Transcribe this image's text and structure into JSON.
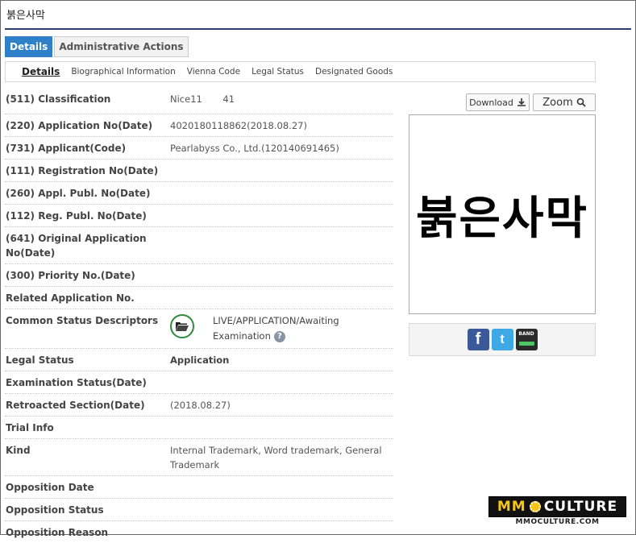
{
  "page_title": "붉은사막",
  "tabs": [
    {
      "label": "Details",
      "active": true
    },
    {
      "label": "Administrative Actions",
      "active": false
    }
  ],
  "subnav": [
    "Details",
    "Biographical Information",
    "Vienna Code",
    "Legal Status",
    "Designated Goods"
  ],
  "fields": {
    "classification": {
      "label": "(511) Classification",
      "value": "Nice11       41"
    },
    "application_no": {
      "label": "(220) Application No(Date)",
      "value": "4020180118862(2018.08.27)"
    },
    "applicant": {
      "label": "(731) Applicant(Code)",
      "value": "Pearlabyss Co., Ltd.(120140691465)"
    },
    "registration_no": {
      "label": "(111) Registration No(Date)",
      "value": ""
    },
    "appl_publ_no": {
      "label": "(260) Appl. Publ. No(Date)",
      "value": ""
    },
    "reg_publ_no": {
      "label": "(112) Reg. Publ. No(Date)",
      "value": ""
    },
    "original_application": {
      "label": "(641) Original Application No(Date)",
      "value": ""
    },
    "priority_no": {
      "label": "(300) Priority No.(Date)",
      "value": ""
    },
    "related_application": {
      "label": "Related Application No.",
      "value": ""
    },
    "common_status": {
      "label": "Common Status Descriptors",
      "value": "LIVE/APPLICATION/Awaiting Examination"
    },
    "legal_status": {
      "label": "Legal Status",
      "value": "Application"
    },
    "examination_status": {
      "label": "Examination Status(Date)",
      "value": ""
    },
    "retroacted_section": {
      "label": "Retroacted Section(Date)",
      "value": "(2018.08.27)"
    },
    "trial_info": {
      "label": "Trial Info",
      "value": ""
    },
    "kind": {
      "label": "Kind",
      "value": "Internal Trademark, Word trademark, General Trademark"
    },
    "opposition_date": {
      "label": "Opposition Date",
      "value": ""
    },
    "opposition_status": {
      "label": "Opposition Status",
      "value": ""
    },
    "opposition_reason": {
      "label": "Opposition Reason",
      "value": ""
    }
  },
  "buttons": {
    "download": "Download",
    "zoom": "Zoom"
  },
  "mark_image_text": "붉은사막",
  "share": {
    "facebook": "f",
    "twitter": "t",
    "band": "BAND"
  },
  "watermark": {
    "brand_left": "MM",
    "brand_right": "CULTURE",
    "url": "MMOCULTURE.COM"
  },
  "colors": {
    "tab_active": "#2f80c8",
    "title_rule": "#2c3e6b",
    "status_ring": "#2e8b3e"
  }
}
